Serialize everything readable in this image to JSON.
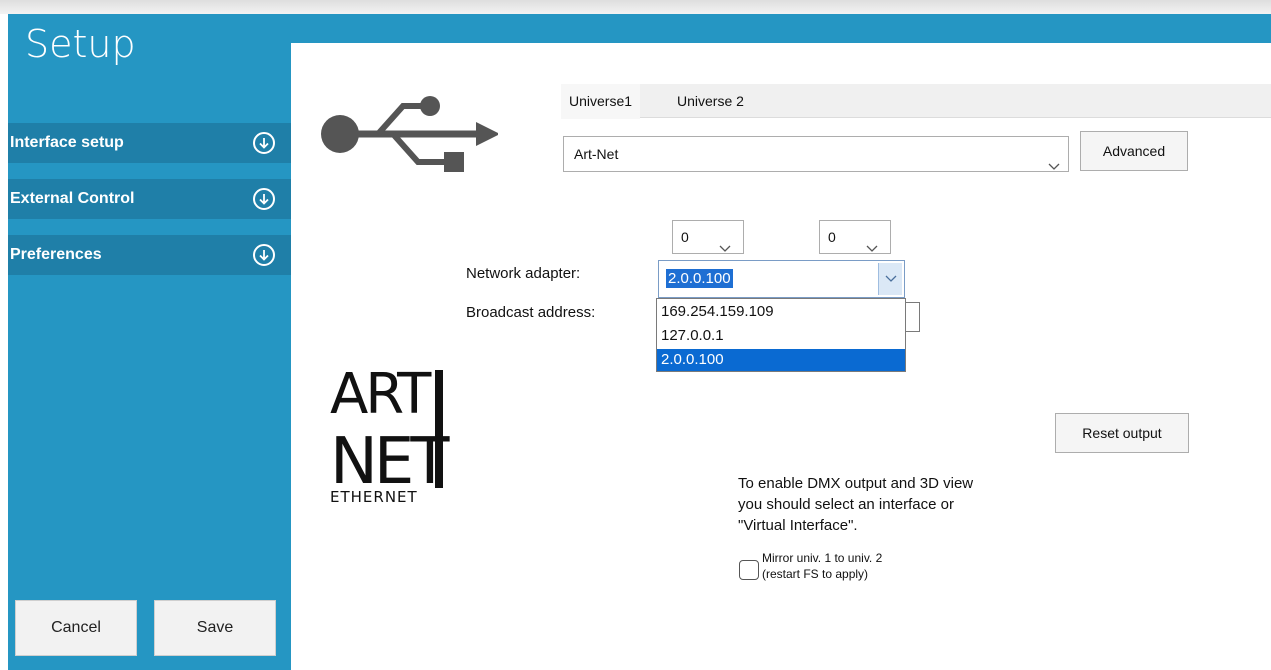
{
  "app": {
    "title": "Setup"
  },
  "sidebar": {
    "items": [
      {
        "label": "Interface setup",
        "icon": "arrow-down-circle-icon"
      },
      {
        "label": "External Control",
        "icon": "arrow-down-circle-icon"
      },
      {
        "label": "Preferences",
        "icon": "arrow-down-circle-icon"
      }
    ],
    "cancel_label": "Cancel",
    "save_label": "Save"
  },
  "tabs": [
    {
      "label": "Universe1",
      "active": true
    },
    {
      "label": "Universe 2",
      "active": false
    }
  ],
  "interface": {
    "selected": "Art-Net",
    "advanced_label": "Advanced"
  },
  "artnet": {
    "subnet_value": "0",
    "universe_value": "0",
    "network_adapter_label": "Network adapter:",
    "network_adapter_value": "2.0.0.100",
    "broadcast_label": "Broadcast address:",
    "adapter_options": [
      "169.254.159.109",
      "127.0.0.1",
      "2.0.0.100"
    ],
    "selected_option_index": 2
  },
  "logo": {
    "line1": "ART",
    "line2": "NET",
    "line3": "ETHERNET"
  },
  "reset_label": "Reset output",
  "info": {
    "line1": "To enable DMX output and 3D view",
    "line2": "you should select an interface or",
    "line3": "\"Virtual Interface\"."
  },
  "mirror": {
    "line1": "Mirror univ. 1 to univ. 2",
    "line2": "(restart FS to apply)",
    "checked": false
  },
  "colors": {
    "sidebar_blue": "#2596c3",
    "sidebar_item_blue": "#1f7fa8",
    "selection_blue": "#0a6ad2"
  }
}
